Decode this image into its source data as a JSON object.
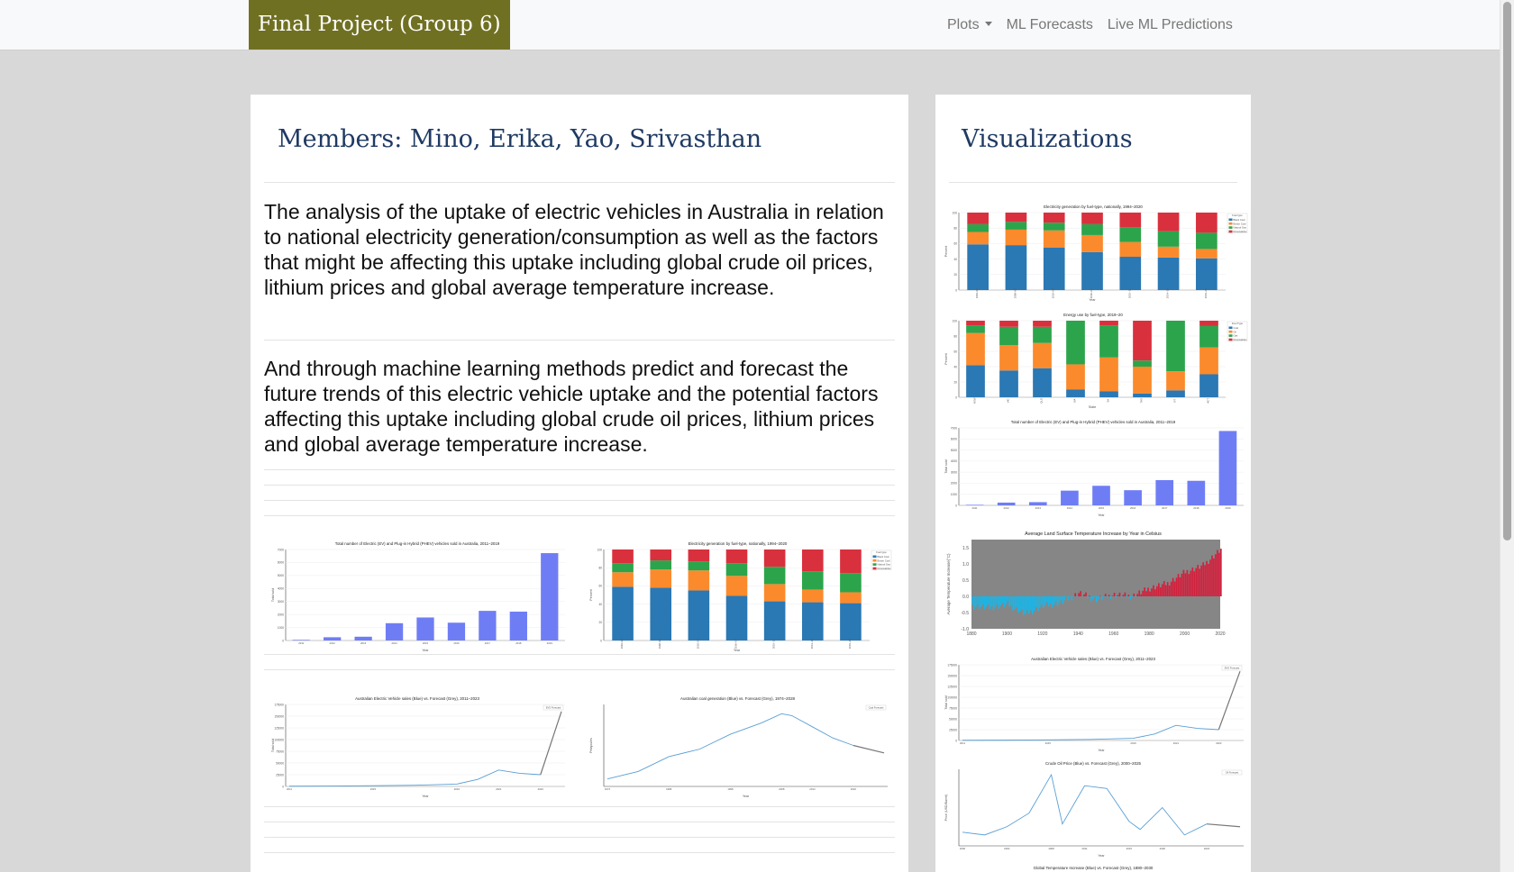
{
  "navbar": {
    "brand": "Final Project (Group 6)",
    "plots_label": "Plots",
    "forecasts_label": "ML Forecasts",
    "predictions_label": "Live ML Predictions"
  },
  "main": {
    "title": "Members: Mino, Erika, Yao, Srivasthan",
    "paragraph_1": "The analysis of the uptake of electric vehicles in Australia in relation to national electricity generation/consumption as well as the factors that might be affecting this uptake including global crude oil prices, lithium prices and global average temperature increase.",
    "paragraph_2": "And through machine learning methods predict and forecast the future trends of this electric vehicle uptake and the potential factors affecting this uptake including global crude oil prices, lithium prices and global average temperature increase."
  },
  "sidebar": {
    "title": "Visualizations"
  },
  "colors": {
    "brand_bg": "#707022",
    "title_color": "#1f3a63",
    "ev_bar": "#6f7df5",
    "coal": "#2a78b4",
    "gas": "#fb8a2c",
    "renewables": "#2ca44b",
    "other": "#d9303e",
    "temp_warm": "#d41f3c",
    "temp_cool": "#19b6e8",
    "temp_bg": "#868686"
  },
  "chart_data": [
    {
      "id": "ev-sales",
      "type": "bar",
      "title": "Total number of Electric (EV) and Plug-in Hybrid (PHEV) vehicles sold in Australia, 2011–2019",
      "xlabel": "Year",
      "ylabel": "Total sold",
      "categories": [
        "2011",
        "2012",
        "2013",
        "2014",
        "2015",
        "2016",
        "2017",
        "2018",
        "2019"
      ],
      "values": [
        49,
        250,
        290,
        1330,
        1770,
        1370,
        2280,
        2220,
        6720
      ],
      "ylim": [
        0,
        7000
      ],
      "yticks": [
        0,
        1000,
        2000,
        3000,
        4000,
        5000,
        6000,
        7000
      ]
    },
    {
      "id": "electricity-generation",
      "type": "bar",
      "title": "Electricity generation by fuel-type, nationally, 1994–2020",
      "xlabel": "Year",
      "ylabel": "Percent",
      "legend_title": "Fuel type",
      "legend_position": "top-right",
      "categories": [
        "1994–95",
        "1998–99",
        "2002–03",
        "2006–07",
        "2010–11",
        "2014–15",
        "2019–20"
      ],
      "series": [
        {
          "name": "Black Coal",
          "values": [
            59,
            58,
            55,
            49,
            43,
            42,
            41
          ]
        },
        {
          "name": "Brown Coal",
          "values": [
            16,
            20,
            22,
            22,
            19,
            14,
            12
          ]
        },
        {
          "name": "Natural Gas",
          "values": [
            10,
            10,
            10,
            14,
            19,
            20,
            21
          ]
        },
        {
          "name": "Renewables",
          "values": [
            15,
            12,
            13,
            15,
            19,
            24,
            26
          ]
        }
      ],
      "ylim": [
        0,
        100
      ],
      "yticks": [
        0,
        20,
        40,
        60,
        80,
        100
      ]
    },
    {
      "id": "energy-by-state",
      "type": "bar",
      "title": "Energy use by fuel-type, 2019–20",
      "xlabel": "State",
      "ylabel": "Percent",
      "legend_title": "Fuel Type",
      "legend_position": "top-right",
      "categories": [
        "NSW",
        "VIC",
        "QLD",
        "WA",
        "SA",
        "TAS",
        "NT",
        "ACT"
      ],
      "series": [
        {
          "name": "Coal",
          "values": [
            42,
            35,
            38,
            10,
            8,
            5,
            9,
            30
          ]
        },
        {
          "name": "Oil",
          "values": [
            42,
            33,
            33,
            33,
            44,
            35,
            25,
            35
          ]
        },
        {
          "name": "Gas",
          "values": [
            10,
            24,
            21,
            57,
            42,
            8,
            66,
            28
          ]
        },
        {
          "name": "Renewables",
          "values": [
            6,
            8,
            8,
            0,
            6,
            52,
            0,
            7
          ]
        }
      ],
      "ylim": [
        0,
        100
      ],
      "yticks": [
        0,
        20,
        40,
        60,
        80,
        100
      ]
    },
    {
      "id": "land-temperature",
      "type": "bar",
      "title": "Average Land Surface Temperature Increase by Year in Celsius",
      "ylabel": "Average Temperature Increase(°C)",
      "ylim": [
        -1.0,
        1.75
      ],
      "yticks": [
        -1.0,
        -0.5,
        0.0,
        0.5,
        1.0,
        1.5
      ],
      "xticks": [
        1880,
        1900,
        1920,
        1940,
        1960,
        1980,
        2000,
        2020
      ],
      "x": [
        1880,
        1890,
        1900,
        1910,
        1920,
        1930,
        1940,
        1950,
        1960,
        1970,
        1980,
        1990,
        2000,
        2010,
        2020
      ],
      "values": [
        -0.3,
        -0.35,
        -0.25,
        -0.55,
        -0.3,
        -0.2,
        0.1,
        -0.1,
        0.05,
        0.0,
        0.25,
        0.4,
        0.75,
        0.95,
        1.45
      ]
    },
    {
      "id": "ev-forecast",
      "type": "line",
      "title": "Australian Electric Vehicle sales (Blue) vs. Forecast (Grey), 2011–2023",
      "xlabel": "Year",
      "ylabel": "Total sold",
      "legend": "EVS Forecast",
      "legend_position": "top-right",
      "x": [
        2011,
        2013,
        2015,
        2017,
        2019,
        2020,
        2021,
        2022,
        2023,
        2024
      ],
      "values": [
        500,
        800,
        1500,
        2500,
        5000,
        15000,
        35000,
        28000,
        25000,
        160000
      ],
      "ylim": [
        0,
        175000
      ],
      "yticks": [
        0,
        25000,
        50000,
        75000,
        100000,
        125000,
        150000,
        175000
      ]
    },
    {
      "id": "coal-forecast",
      "type": "line",
      "title": "Australian coal generation (Blue) vs. Forecast (Grey), 1974–2028",
      "xlabel": "Year",
      "ylabel": "Petajoules",
      "legend": "Coal Forecast",
      "legend_position": "top-right",
      "x": [
        1974,
        1980,
        1986,
        1992,
        1998,
        2004,
        2008,
        2010,
        2014,
        2018,
        2022,
        2028
      ],
      "values": [
        1000,
        1200,
        1600,
        1800,
        2200,
        2500,
        2750,
        2700,
        2400,
        2100,
        1900,
        1700
      ],
      "ylim": [
        800,
        3000
      ]
    },
    {
      "id": "oil-forecast",
      "type": "line",
      "title": "Crude Oil Price (Blue) vs. Forecast (Grey), 2000–2025",
      "xlabel": "Year",
      "ylabel": "Price (USD/Barrel)",
      "legend": "Oil Forecast",
      "legend_position": "top-right",
      "x": [
        2000,
        2002,
        2004,
        2006,
        2008,
        2009,
        2011,
        2013,
        2015,
        2016,
        2018,
        2020,
        2022,
        2025
      ],
      "values": [
        25,
        20,
        35,
        60,
        130,
        40,
        110,
        105,
        45,
        30,
        70,
        20,
        40,
        35
      ],
      "ylim": [
        0,
        140
      ]
    },
    {
      "id": "global-temp-forecast",
      "type": "line",
      "title": "Global Temperature Increase (Blue) vs. Forecast (Grey), 1880–2030"
    }
  ]
}
